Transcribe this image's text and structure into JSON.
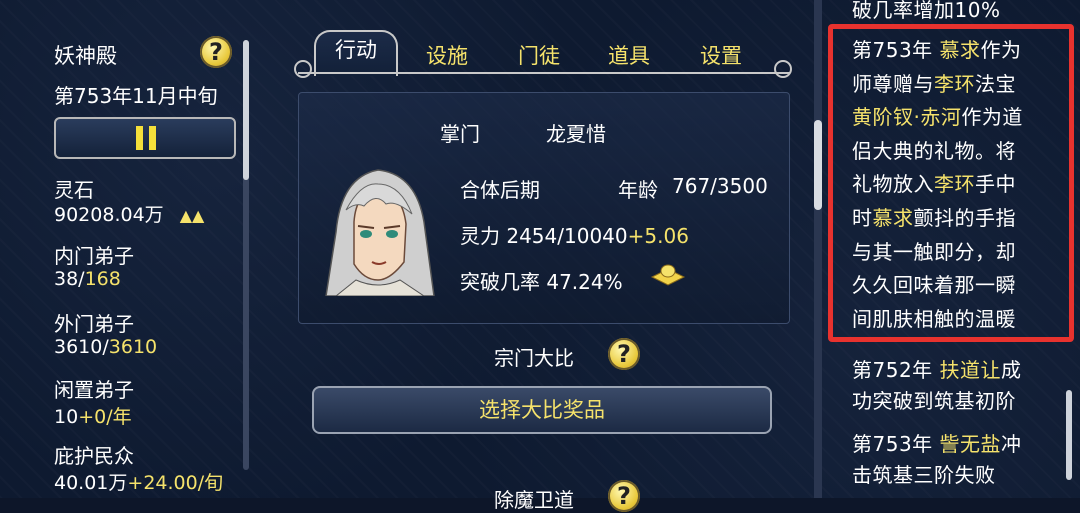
{
  "sect": {
    "name": "妖神殿",
    "date": "第753年11月中旬",
    "help_icon": "?"
  },
  "resources": [
    {
      "label": "灵石",
      "value": "90208.04万",
      "arrows": "▲▲"
    },
    {
      "label": "内门弟子",
      "value_main": "38/",
      "value_accent": "168"
    },
    {
      "label": "外门弟子",
      "value_main": "3610/",
      "value_accent": "3610"
    },
    {
      "label": "闲置弟子",
      "value_main": "10",
      "value_accent": "+0/年"
    },
    {
      "label": "庇护民众",
      "value_main": "40.01万",
      "value_accent": "+24.00/旬"
    }
  ],
  "tabs": [
    {
      "label": "行动",
      "active": true
    },
    {
      "label": "设施",
      "active": false
    },
    {
      "label": "门徒",
      "active": false
    },
    {
      "label": "道具",
      "active": false
    },
    {
      "label": "设置",
      "active": false
    }
  ],
  "leader": {
    "title_label": "掌门",
    "name": "龙夏惜",
    "realm": "合体后期",
    "age_label": "年龄",
    "age_value": "767/3500",
    "spirit_label": "灵力",
    "spirit_value": "2454/10040",
    "spirit_gain": "+5.06",
    "breakthrough_label": "突破几率",
    "breakthrough_value": "47.24%"
  },
  "contest": {
    "label": "宗门大比",
    "button": "选择大比奖品",
    "next_label": "除魔卫道"
  },
  "log": {
    "top_cut": "破几率增加10%",
    "entry1": [
      [
        {
          "t": "第753年 "
        },
        {
          "t": "慕求",
          "n": true
        },
        {
          "t": "作为"
        }
      ],
      [
        {
          "t": "师尊赠与"
        },
        {
          "t": "李环",
          "n": true
        },
        {
          "t": "法宝"
        }
      ],
      [
        {
          "t": "黄阶钗·赤河",
          "n": true
        },
        {
          "t": "作为道"
        }
      ],
      [
        {
          "t": "侣大典的礼物。将"
        }
      ],
      [
        {
          "t": "礼物放入"
        },
        {
          "t": "李环",
          "n": true
        },
        {
          "t": "手中"
        }
      ],
      [
        {
          "t": "时"
        },
        {
          "t": "慕求",
          "n": true
        },
        {
          "t": "颤抖的手指"
        }
      ],
      [
        {
          "t": "与其一触即分，却"
        }
      ],
      [
        {
          "t": "久久回味着那一瞬"
        }
      ],
      [
        {
          "t": "间肌肤相触的温暖"
        }
      ]
    ],
    "entry2": [
      [
        {
          "t": "第752年 "
        },
        {
          "t": "扶道让",
          "n": true
        },
        {
          "t": "成"
        }
      ],
      [
        {
          "t": "功突破到筑基初阶"
        }
      ]
    ],
    "entry3": [
      [
        {
          "t": "第753年 "
        },
        {
          "t": "訾无盐",
          "n": true
        },
        {
          "t": "冲"
        }
      ],
      [
        {
          "t": "击筑基三阶失败"
        }
      ]
    ]
  },
  "colors": {
    "accent": "#f5e26b",
    "highlight": "#e8322e",
    "background": "#0e1a30"
  }
}
